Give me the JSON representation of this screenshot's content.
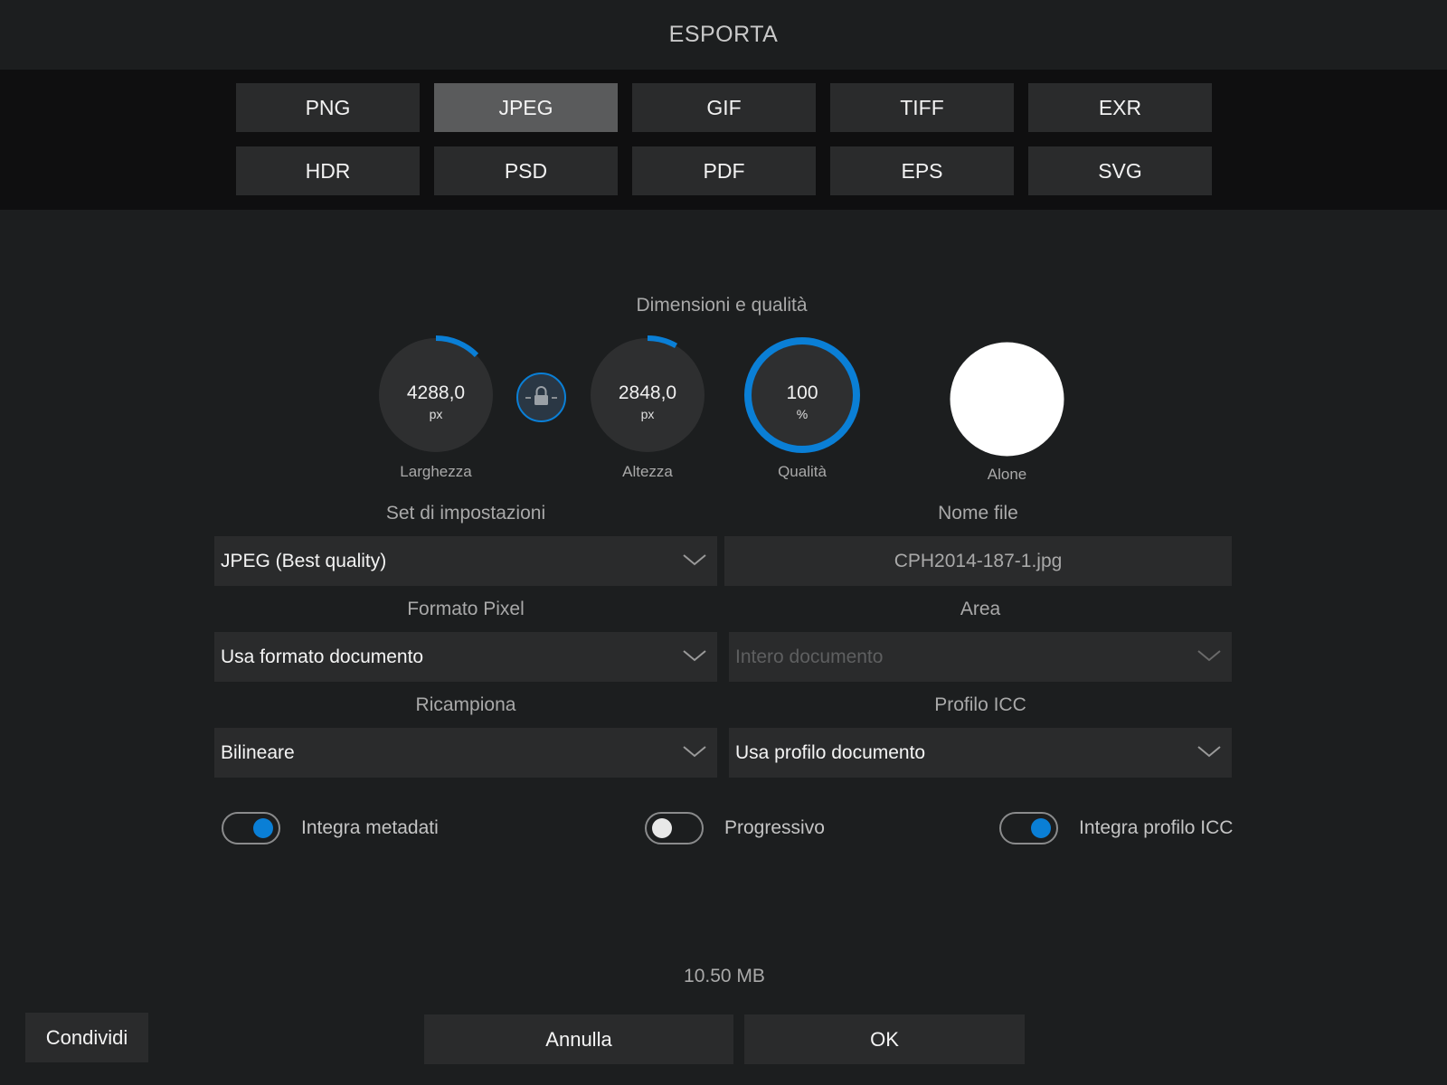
{
  "header": {
    "title": "ESPORTA"
  },
  "formats": {
    "row1": [
      "PNG",
      "JPEG",
      "GIF",
      "TIFF",
      "EXR"
    ],
    "row2": [
      "HDR",
      "PSD",
      "PDF",
      "EPS",
      "SVG"
    ],
    "selected": "JPEG"
  },
  "dimensions": {
    "section_title": "Dimensioni e qualità",
    "width": {
      "value": "4288,0",
      "unit": "px",
      "label": "Larghezza"
    },
    "height": {
      "value": "2848,0",
      "unit": "px",
      "label": "Altezza"
    },
    "quality": {
      "value": "100",
      "unit": "%",
      "label": "Qualità",
      "level_percent": 100
    },
    "matte": {
      "label": "Alone",
      "color": "#ffffff"
    },
    "lock_icon": "lock-icon"
  },
  "form": {
    "preset": {
      "label": "Set di impostazioni",
      "value": "JPEG (Best quality)"
    },
    "filename": {
      "label": "Nome file",
      "value": "CPH2014-187-1.jpg"
    },
    "pixel_format": {
      "label": "Formato Pixel",
      "value": "Usa formato documento"
    },
    "area": {
      "label": "Area",
      "value": "Intero documento"
    },
    "resample": {
      "label": "Ricampiona",
      "value": "Bilineare"
    },
    "icc_profile": {
      "label": "Profilo ICC",
      "value": "Usa profilo documento"
    }
  },
  "toggles": {
    "embed_metadata": {
      "label": "Integra metadati",
      "on": true
    },
    "progressive": {
      "label": "Progressivo",
      "on": false
    },
    "embed_icc": {
      "label": "Integra profilo ICC",
      "on": true
    }
  },
  "footer": {
    "file_size": "10.50 MB",
    "share": "Condividi",
    "cancel": "Annulla",
    "ok": "OK"
  },
  "colors": {
    "accent": "#0a7fd6",
    "background": "#1c1e1f",
    "button": "#2a2b2c",
    "button_selected": "#5a5b5c"
  }
}
